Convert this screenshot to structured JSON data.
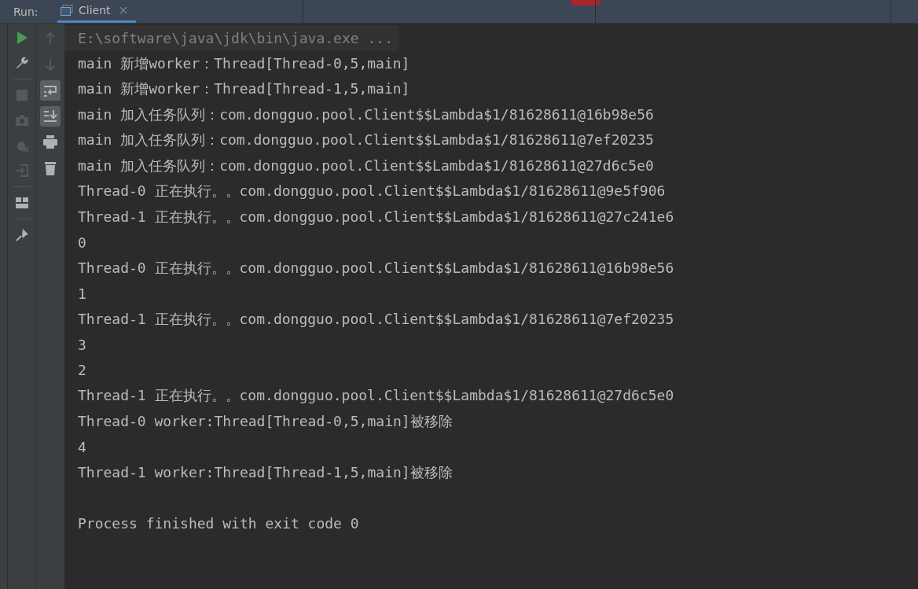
{
  "run_bar": {
    "label": "Run:",
    "tabs": [
      {
        "label": "Client",
        "selected": true
      }
    ]
  },
  "left_toolbar": [
    {
      "kind": "run",
      "disabled": false
    },
    {
      "kind": "wrench",
      "disabled": false
    },
    {
      "kind": "stop",
      "disabled": true
    },
    {
      "kind": "camera",
      "disabled": true
    },
    {
      "kind": "bug",
      "disabled": true
    },
    {
      "kind": "exit",
      "disabled": true
    },
    {
      "kind": "layout",
      "disabled": false
    },
    {
      "kind": "pin",
      "disabled": false
    }
  ],
  "right_toolbar": [
    {
      "kind": "up",
      "disabled": true,
      "on": false
    },
    {
      "kind": "down",
      "disabled": true,
      "on": false
    },
    {
      "kind": "wrap",
      "disabled": false,
      "on": true
    },
    {
      "kind": "scroll",
      "disabled": false,
      "on": true
    },
    {
      "kind": "print",
      "disabled": false,
      "on": false
    },
    {
      "kind": "trash",
      "disabled": false,
      "on": false
    }
  ],
  "console": [
    {
      "kind": "command",
      "text": "E:\\software\\java\\jdk\\bin\\java.exe ..."
    },
    {
      "kind": "output",
      "text": "main 新增worker：Thread[Thread-0,5,main]"
    },
    {
      "kind": "output",
      "text": "main 新增worker：Thread[Thread-1,5,main]"
    },
    {
      "kind": "output",
      "text": "main 加入任务队列：com.dongguo.pool.Client$$Lambda$1/81628611@16b98e56"
    },
    {
      "kind": "output",
      "text": "main 加入任务队列：com.dongguo.pool.Client$$Lambda$1/81628611@7ef20235"
    },
    {
      "kind": "output",
      "text": "main 加入任务队列：com.dongguo.pool.Client$$Lambda$1/81628611@27d6c5e0"
    },
    {
      "kind": "output",
      "text": "Thread-0 正在执行。。com.dongguo.pool.Client$$Lambda$1/81628611@9e5f906"
    },
    {
      "kind": "output",
      "text": "Thread-1 正在执行。。com.dongguo.pool.Client$$Lambda$1/81628611@27c241e6"
    },
    {
      "kind": "output",
      "text": "0"
    },
    {
      "kind": "output",
      "text": "Thread-0 正在执行。。com.dongguo.pool.Client$$Lambda$1/81628611@16b98e56"
    },
    {
      "kind": "output",
      "text": "1"
    },
    {
      "kind": "output",
      "text": "Thread-1 正在执行。。com.dongguo.pool.Client$$Lambda$1/81628611@7ef20235"
    },
    {
      "kind": "output",
      "text": "3"
    },
    {
      "kind": "output",
      "text": "2"
    },
    {
      "kind": "output",
      "text": "Thread-1 正在执行。。com.dongguo.pool.Client$$Lambda$1/81628611@27d6c5e0"
    },
    {
      "kind": "output",
      "text": "Thread-0 worker:Thread[Thread-0,5,main]被移除"
    },
    {
      "kind": "output",
      "text": "4"
    },
    {
      "kind": "output",
      "text": "Thread-1 worker:Thread[Thread-1,5,main]被移除"
    },
    {
      "kind": "blank"
    },
    {
      "kind": "output",
      "text": "Process finished with exit code 0"
    }
  ]
}
